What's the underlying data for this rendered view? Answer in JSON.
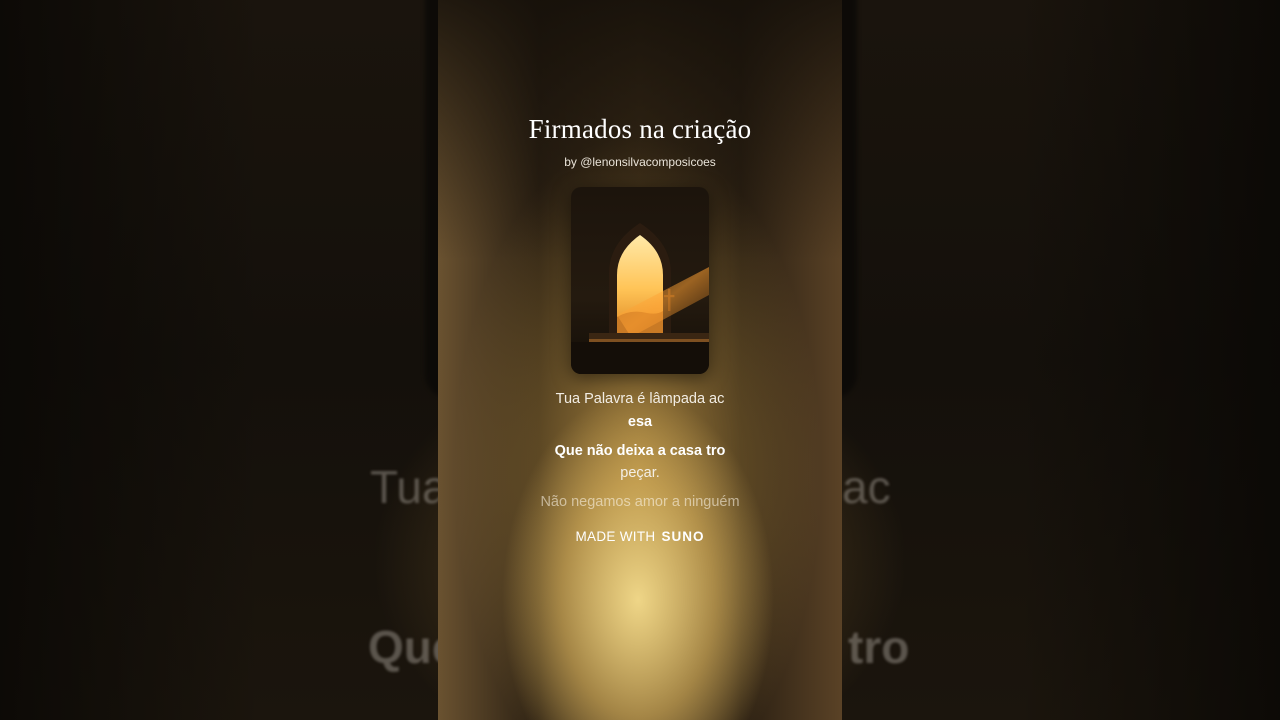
{
  "background": {
    "line1_left": "Tua",
    "line1_right": "ac",
    "line2_left": "Que",
    "line2_right": "tro"
  },
  "song": {
    "title": "Firmados na criação",
    "byline": "by @lenonsilvacomposicoes"
  },
  "artwork": {
    "description_icon": "church-window-cross-artwork"
  },
  "lyrics": [
    "Tua Palavra é lâmpada ac",
    "esa",
    "Que não deixa a casa tro",
    "peçar.",
    "Não negamos amor a ninguém"
  ],
  "footer": {
    "made_with": "MADE WITH",
    "brand": "SUNO"
  },
  "colors": {
    "glow": "#f5dc8c",
    "text": "#ffffff"
  }
}
